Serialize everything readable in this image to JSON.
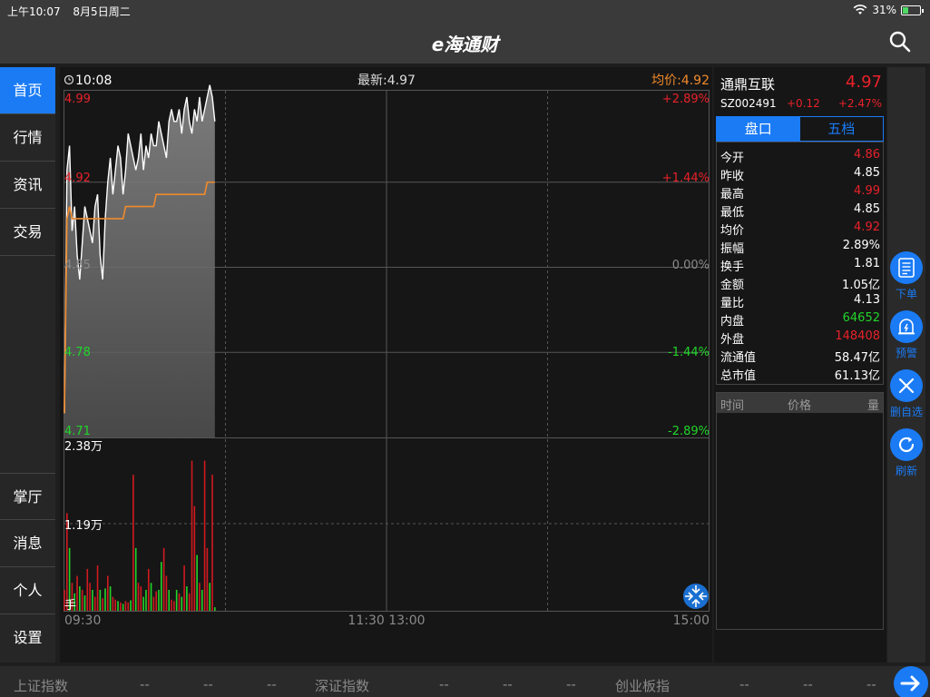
{
  "status_bar": {
    "time": "上午10:07",
    "date": "8月5日周二",
    "battery": "31%",
    "battery_level": 0.31
  },
  "app": {
    "logo": "e海通财"
  },
  "sidebar": {
    "top_items": [
      {
        "label": "首页"
      },
      {
        "label": "行情"
      },
      {
        "label": "资讯"
      },
      {
        "label": "交易"
      }
    ],
    "bottom_items": [
      {
        "label": "掌厅"
      },
      {
        "label": "消息"
      },
      {
        "label": "个人"
      },
      {
        "label": "设置"
      }
    ],
    "active": "首页"
  },
  "chart_header": {
    "time": "10:08",
    "latest": "最新:4.97",
    "avg": "均价:4.92"
  },
  "chart_data": {
    "type": "line",
    "price_axis": {
      "labels": [
        "4.99",
        "4.92",
        "4.85",
        "4.78",
        "4.71"
      ],
      "values": [
        4.99,
        4.92,
        4.85,
        4.78,
        4.71
      ],
      "ylim": [
        4.71,
        4.99
      ]
    },
    "pct_axis": {
      "labels": [
        "+2.89%",
        "+1.44%",
        "0.00%",
        "-1.44%",
        "-2.89%"
      ]
    },
    "volume_axis": {
      "labels": [
        "2.38万",
        "1.19万"
      ],
      "unit": "手",
      "max": 23800
    },
    "time_labels": [
      "09:30",
      "11:30 13:00",
      "15:00"
    ],
    "session_minutes": 240,
    "price_line": [
      4.73,
      4.93,
      4.95,
      4.88,
      4.9,
      4.86,
      4.84,
      4.87,
      4.9,
      4.89,
      4.88,
      4.87,
      4.9,
      4.91,
      4.86,
      4.84,
      4.89,
      4.92,
      4.94,
      4.91,
      4.93,
      4.95,
      4.94,
      4.91,
      4.93,
      4.96,
      4.95,
      4.94,
      4.93,
      4.94,
      4.96,
      4.93,
      4.95,
      4.94,
      4.96,
      4.95,
      4.95,
      4.97,
      4.96,
      4.95,
      4.94,
      4.97,
      4.98,
      4.97,
      4.97,
      4.98,
      4.96,
      4.98,
      4.99,
      4.97,
      4.96,
      4.98,
      4.97,
      4.99,
      4.97,
      4.98,
      4.99,
      5.0,
      4.99,
      4.97
    ],
    "avg_line": [
      4.73,
      4.89,
      4.9,
      4.89,
      4.89,
      4.89,
      4.89,
      4.89,
      4.89,
      4.89,
      4.89,
      4.89,
      4.89,
      4.89,
      4.89,
      4.89,
      4.89,
      4.89,
      4.89,
      4.89,
      4.89,
      4.89,
      4.89,
      4.89,
      4.9,
      4.9,
      4.9,
      4.9,
      4.9,
      4.9,
      4.9,
      4.9,
      4.9,
      4.9,
      4.9,
      4.9,
      4.91,
      4.91,
      4.91,
      4.91,
      4.91,
      4.91,
      4.91,
      4.91,
      4.91,
      4.91,
      4.91,
      4.91,
      4.91,
      4.91,
      4.91,
      4.91,
      4.91,
      4.91,
      4.91,
      4.91,
      4.92,
      4.92,
      4.92,
      4.92
    ],
    "volume": [
      3000,
      14000,
      9000,
      4000,
      2500,
      5000,
      3500,
      3000,
      2200,
      6000,
      4000,
      3000,
      2000,
      6500,
      3000,
      1800,
      3200,
      5000,
      3500,
      2000,
      1600,
      1400,
      1200,
      1000,
      1400,
      1200,
      1500,
      19500,
      9000,
      4000,
      3500,
      2000,
      3000,
      6000,
      4000,
      2000,
      2800,
      3000,
      7000,
      9000,
      5000,
      3000,
      1600,
      1400,
      3000,
      2500,
      2000,
      6500,
      3500,
      2500,
      21500,
      15000,
      8000,
      4000,
      3000,
      21500,
      9000,
      4000,
      19500,
      500
    ],
    "volume_color": [
      "r",
      "r",
      "g",
      "r",
      "g",
      "r",
      "g",
      "r",
      "g",
      "r",
      "r",
      "g",
      "r",
      "r",
      "g",
      "r",
      "g",
      "r",
      "g",
      "r",
      "r",
      "g",
      "r",
      "g",
      "r",
      "r",
      "g",
      "r",
      "g",
      "r",
      "r",
      "g",
      "g",
      "r",
      "g",
      "r",
      "r",
      "g",
      "g",
      "r",
      "r",
      "g",
      "r",
      "r",
      "g",
      "r",
      "g",
      "r",
      "g",
      "r",
      "r",
      "r",
      "g",
      "r",
      "g",
      "r",
      "r",
      "g",
      "r",
      "g"
    ]
  },
  "stock": {
    "name": "通鼎互联",
    "price": "4.97",
    "code": "SZ002491",
    "change": "+0.12",
    "change_pct": "+2.47%"
  },
  "panel_tabs": [
    {
      "label": "盘口"
    },
    {
      "label": "五档"
    }
  ],
  "quote_rows": [
    {
      "key": "今开",
      "value": "4.86",
      "color": "red"
    },
    {
      "key": "昨收",
      "value": "4.85",
      "color": "white"
    },
    {
      "key": "最高",
      "value": "4.99",
      "color": "red"
    },
    {
      "key": "最低",
      "value": "4.85",
      "color": "white"
    },
    {
      "key": "均价",
      "value": "4.92",
      "color": "red"
    },
    {
      "key": "振幅",
      "value": "2.89%",
      "color": "white"
    },
    {
      "key": "换手",
      "value": "1.81",
      "color": "white"
    },
    {
      "key": "金额",
      "value": "1.05亿",
      "color": "white"
    },
    {
      "key": "量比",
      "value": "4.13",
      "color": "white"
    },
    {
      "key": "内盘",
      "value": "64652",
      "color": "green"
    },
    {
      "key": "外盘",
      "value": "148408",
      "color": "red"
    },
    {
      "key": "流通值",
      "value": "58.47亿",
      "color": "white"
    },
    {
      "key": "总市值",
      "value": "61.13亿",
      "color": "white"
    }
  ],
  "ticks_header": {
    "time": "时间",
    "price": "价格",
    "volume": "量"
  },
  "float_buttons": [
    {
      "label": "下单",
      "icon": "order-icon"
    },
    {
      "label": "预警",
      "icon": "alarm-bell-icon"
    },
    {
      "label": "删自选",
      "icon": "close-icon"
    },
    {
      "label": "刷新",
      "icon": "refresh-icon"
    }
  ],
  "bottom_bar": {
    "indices": [
      {
        "name": "上证指数",
        "values": [
          "--",
          "--",
          "--"
        ]
      },
      {
        "name": "深证指数",
        "values": [
          "--",
          "--",
          "--"
        ]
      },
      {
        "name": "创业板指",
        "values": [
          "--",
          "--",
          "--"
        ]
      }
    ]
  },
  "colors": {
    "accent": "#1a7bf5",
    "up": "#e8212a",
    "down": "#22d52a",
    "avg_line": "#f08a2c"
  }
}
